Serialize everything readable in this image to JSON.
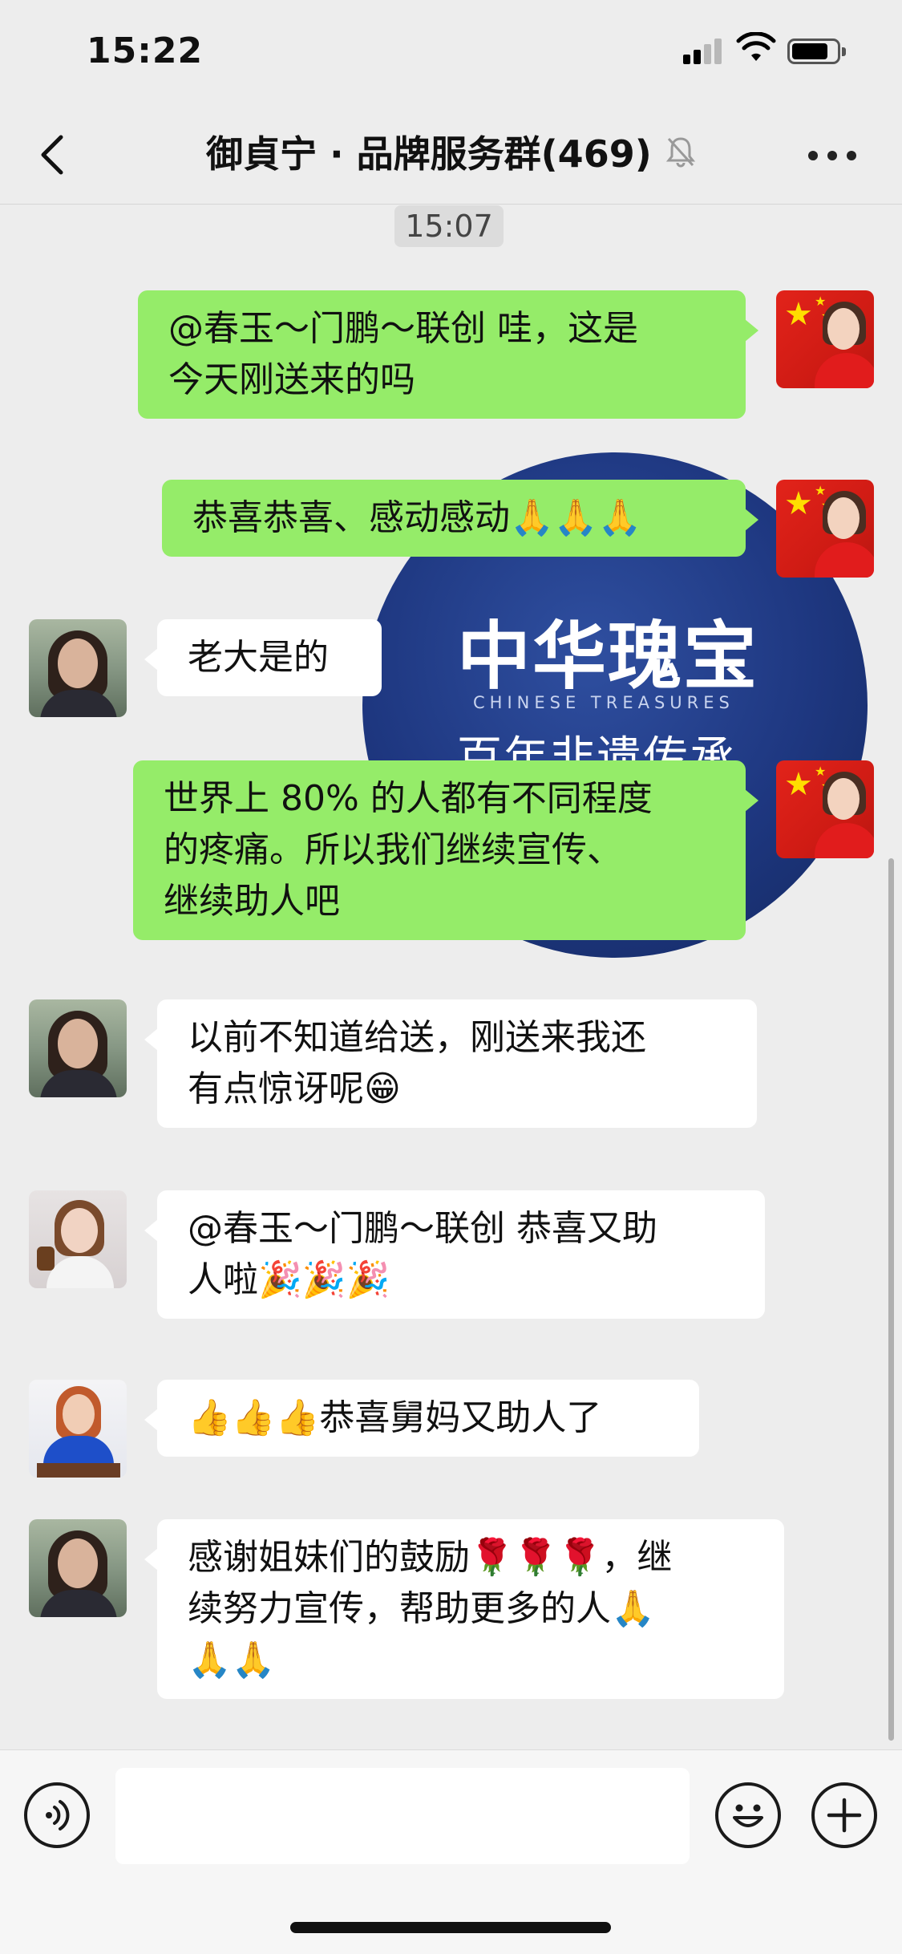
{
  "status_bar": {
    "time": "15:22"
  },
  "nav": {
    "title": "御貞宁 · 品牌服务群(469)",
    "muted": true
  },
  "chat": {
    "timestamp": "15:07",
    "poster": {
      "title": "中华瑰宝",
      "subtitle_en": "CHINESE TREASURES",
      "subtitle_cn": "百年非遗传承"
    },
    "messages": [
      {
        "side": "right",
        "text": "@春玉～门鹏～联创 哇，这是\n今天刚送来的吗"
      },
      {
        "side": "right",
        "text": "恭喜恭喜、感动感动🙏🙏🙏"
      },
      {
        "side": "left",
        "text": "老大是的"
      },
      {
        "side": "right",
        "text": "世界上 80% 的人都有不同程度\n的疼痛。所以我们继续宣传、\n继续助人吧"
      },
      {
        "side": "left",
        "text": "以前不知道给送，刚送来我还\n有点惊讶呢😁"
      },
      {
        "side": "left",
        "text": "@春玉～门鹏～联创 恭喜又助\n人啦🎉🎉🎉"
      },
      {
        "side": "left",
        "text": "👍👍👍恭喜舅妈又助人了"
      },
      {
        "side": "left",
        "text": "感谢姐妹们的鼓励🌹🌹🌹，继\n续努力宣传，帮助更多的人🙏\n🙏🙏"
      }
    ]
  },
  "colors": {
    "background": "#ededed",
    "self_bubble": "#95ec69",
    "other_bubble": "#ffffff",
    "poster_blue": "#1e3780"
  },
  "icons": {
    "back": "chevron-left-icon",
    "mute": "bell-slash-icon",
    "more": "more-dots-icon",
    "voice": "voice-icon",
    "emoji": "emoji-icon",
    "plus": "plus-icon"
  }
}
